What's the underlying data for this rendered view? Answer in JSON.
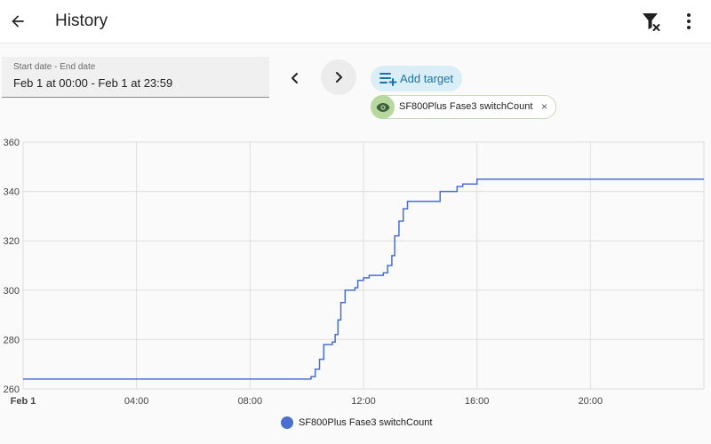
{
  "header": {
    "title": "History",
    "back_icon": "arrow-left-icon",
    "filter_icon": "filter-remove-icon",
    "menu_icon": "dots-vertical-icon"
  },
  "date_picker": {
    "label": "Start date - End date",
    "value": "Feb 1 at 00:00 - Feb 1 at 23:59"
  },
  "nav": {
    "prev_icon": "chevron-left-icon",
    "next_icon": "chevron-right-icon"
  },
  "add_target": {
    "label": "Add target",
    "icon": "playlist-plus-icon"
  },
  "target_chip": {
    "label": "SF800Plus Fase3 switchCount",
    "icon": "eye-icon",
    "remove_label": "×"
  },
  "colors": {
    "accent": "#1a73a8",
    "series": "#4a6fcf",
    "chip_icon_bg": "#b7d9a0"
  },
  "chart_data": {
    "type": "line",
    "title": "",
    "xlabel": "",
    "ylabel": "",
    "x_ticks": [
      "Feb 1",
      "04:00",
      "08:00",
      "12:00",
      "16:00",
      "20:00"
    ],
    "x_tick_hours": [
      0,
      4,
      8,
      12,
      16,
      20
    ],
    "xlim": [
      0,
      24
    ],
    "y_ticks": [
      260,
      280,
      300,
      320,
      340,
      360
    ],
    "ylim": [
      260,
      360
    ],
    "grid": true,
    "legend_position": "bottom",
    "series": [
      {
        "name": "SF800Plus Fase3 switchCount",
        "points": [
          [
            0,
            264
          ],
          [
            10.0,
            264
          ],
          [
            10.15,
            265
          ],
          [
            10.3,
            268
          ],
          [
            10.45,
            272
          ],
          [
            10.6,
            278
          ],
          [
            10.9,
            279
          ],
          [
            11.0,
            282
          ],
          [
            11.1,
            288
          ],
          [
            11.2,
            295
          ],
          [
            11.35,
            300
          ],
          [
            11.7,
            301
          ],
          [
            11.8,
            304
          ],
          [
            12.0,
            305
          ],
          [
            12.2,
            306
          ],
          [
            12.7,
            307
          ],
          [
            12.85,
            310
          ],
          [
            13.0,
            314
          ],
          [
            13.1,
            322
          ],
          [
            13.25,
            328
          ],
          [
            13.4,
            333
          ],
          [
            13.55,
            336
          ],
          [
            14.0,
            336
          ],
          [
            14.5,
            336
          ],
          [
            14.7,
            340
          ],
          [
            15.3,
            342
          ],
          [
            15.5,
            343
          ],
          [
            16.0,
            345
          ],
          [
            24.0,
            345
          ]
        ]
      }
    ]
  }
}
